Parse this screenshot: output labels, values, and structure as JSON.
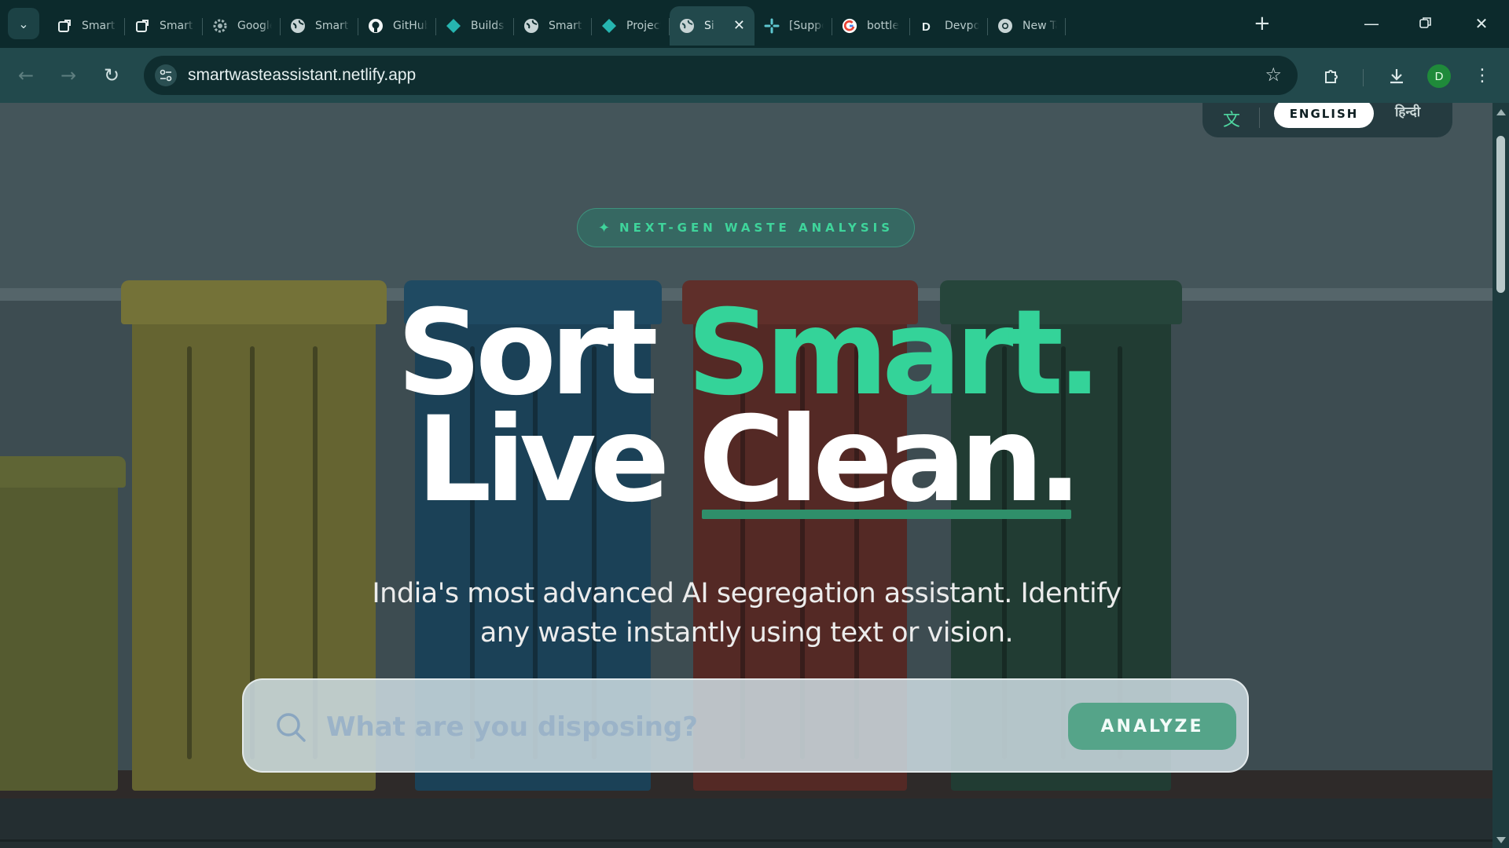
{
  "browser": {
    "tabs": [
      {
        "title": "Smart Waste",
        "icon": "external-tab-icon"
      },
      {
        "title": "Smart Waste",
        "icon": "external-tab-icon"
      },
      {
        "title": "Google",
        "icon": "settings-gear-icon"
      },
      {
        "title": "Smart Waste",
        "icon": "globe-icon"
      },
      {
        "title": "GitHub",
        "icon": "github-icon"
      },
      {
        "title": "Builds |",
        "icon": "netlify-icon"
      },
      {
        "title": "Smart Waste",
        "icon": "globe-icon"
      },
      {
        "title": "Project",
        "icon": "netlify-icon"
      },
      {
        "title": "Si",
        "icon": "globe-icon",
        "active": true
      },
      {
        "title": "[Support]",
        "icon": "slack-icon"
      },
      {
        "title": "bottle",
        "icon": "google-icon"
      },
      {
        "title": "Devpost",
        "icon": "devpost-icon"
      },
      {
        "title": "New Tab",
        "icon": "chrome-icon"
      }
    ],
    "url": "smartwasteassistant.netlify.app",
    "avatar_letter": "D"
  },
  "lang_switch": {
    "english": "ENGLISH",
    "hindi": "हिन्दी"
  },
  "hero": {
    "badge": "NEXT-GEN WASTE ANALYSIS",
    "headline": {
      "w1": "Sort",
      "w2": "Smart.",
      "w3": "Live",
      "w4": "Clean."
    },
    "subtitle": "India's most advanced AI segregation assistant. Identify any waste instantly using text or vision."
  },
  "search": {
    "placeholder": "What are you disposing?",
    "value": "",
    "button": "ANALYZE"
  },
  "colors": {
    "accent": "#34d399",
    "chrome": "#0c2a2c",
    "toolbar": "#22494c"
  }
}
